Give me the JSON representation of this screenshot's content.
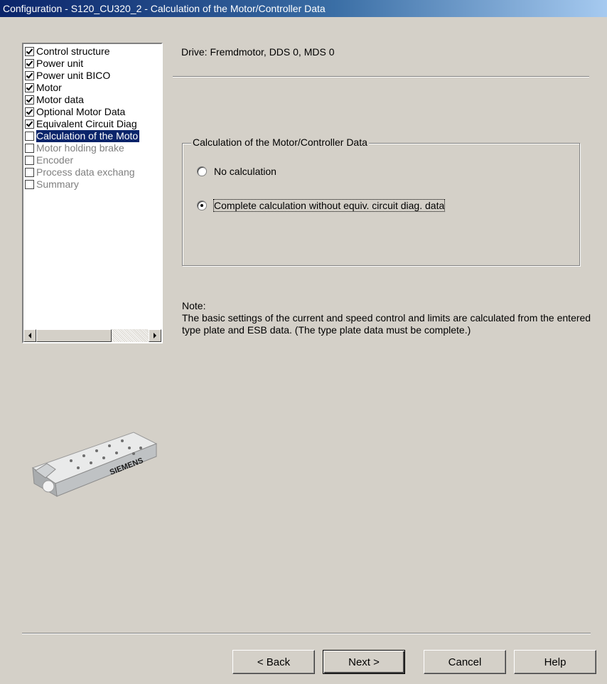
{
  "window": {
    "title": "Configuration - S120_CU320_2 - Calculation of the Motor/Controller Data"
  },
  "tree": {
    "items": [
      {
        "label": "Control structure",
        "checked": true,
        "state": "done"
      },
      {
        "label": "Power unit",
        "checked": true,
        "state": "done"
      },
      {
        "label": "Power unit BICO",
        "checked": true,
        "state": "done"
      },
      {
        "label": "Motor",
        "checked": true,
        "state": "done"
      },
      {
        "label": "Motor data",
        "checked": true,
        "state": "done"
      },
      {
        "label": "Optional Motor Data",
        "checked": true,
        "state": "done"
      },
      {
        "label": "Equivalent Circuit Diag",
        "checked": true,
        "state": "done"
      },
      {
        "label": "Calculation of the Moto",
        "checked": false,
        "state": "selected"
      },
      {
        "label": "Motor holding brake",
        "checked": false,
        "state": "disabled"
      },
      {
        "label": "Encoder",
        "checked": false,
        "state": "disabled"
      },
      {
        "label": "Process data exchang",
        "checked": false,
        "state": "disabled"
      },
      {
        "label": "Summary",
        "checked": false,
        "state": "disabled"
      }
    ]
  },
  "main": {
    "drive_label": "Drive: Fremdmotor, DDS 0, MDS 0",
    "group": {
      "title": "Calculation of the Motor/Controller Data",
      "options": [
        {
          "label": "No calculation",
          "selected": false
        },
        {
          "label": "Complete calculation without equiv. circuit diag. data",
          "selected": true
        }
      ]
    },
    "note_title": "Note:",
    "note_text": "The basic settings of the current and speed control and limits are calculated from the entered type plate and ESB data. (The type plate data must be complete.)"
  },
  "device": {
    "brand": "SIEMENS"
  },
  "buttons": {
    "back": "< Back",
    "next": "Next >",
    "cancel": "Cancel",
    "help": "Help"
  }
}
